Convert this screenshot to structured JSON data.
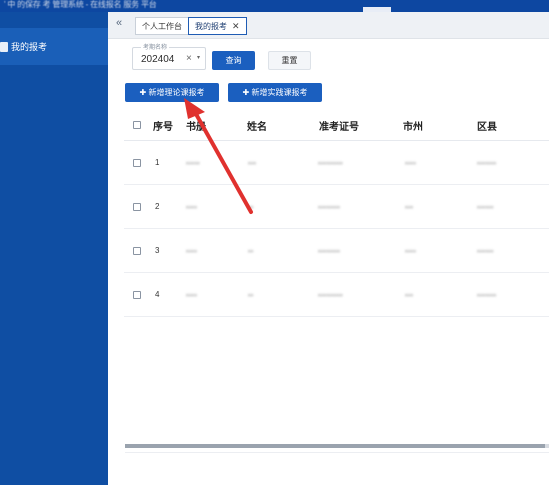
{
  "topbar": {
    "title": "' 中 的保存 考 管理系统 - 在线报名 服务 平台"
  },
  "sidebar": {
    "items": [
      {
        "label": "我的报考",
        "icon": "document-icon"
      }
    ]
  },
  "tabs": [
    {
      "label": "个人工作台"
    },
    {
      "label": "我的报考",
      "close": "✕"
    }
  ],
  "tabbar": {
    "collapse_glyph": "«"
  },
  "filter": {
    "label": "考期名称",
    "value": "202404",
    "clear_glyph": "×",
    "caret_glyph": "▾",
    "query_label": "查询",
    "reset_label": "重置"
  },
  "actions": {
    "add_theory_label": "✚ 新增理论课报考",
    "add_practice_label": "✚ 新增实践课报考"
  },
  "table": {
    "headers": [
      "序号",
      "书册",
      "姓名",
      "准考证号",
      "市州",
      "区县"
    ],
    "rows": [
      {
        "index": "1",
        "c1": "ꞏꞏꞏꞏꞏ",
        "c2": "ꞏꞏꞏ",
        "c3": "ꞏꞏꞏꞏꞏꞏꞏꞏꞏ",
        "c4": "ꞏꞏꞏꞏ",
        "c5": "ꞏꞏꞏꞏꞏꞏꞏ"
      },
      {
        "index": "2",
        "c1": "ꞏꞏꞏꞏ",
        "c2": "ꞏꞏ",
        "c3": "ꞏꞏꞏꞏꞏꞏꞏꞏ",
        "c4": "ꞏꞏꞏ",
        "c5": "ꞏꞏꞏꞏꞏꞏ"
      },
      {
        "index": "3",
        "c1": "ꞏꞏꞏꞏ",
        "c2": "ꞏꞏ",
        "c3": "ꞏꞏꞏꞏꞏꞏꞏꞏ",
        "c4": "ꞏꞏꞏꞏ",
        "c5": "ꞏꞏꞏꞏꞏꞏ"
      },
      {
        "index": "4",
        "c1": "ꞏꞏꞏꞏ",
        "c2": "ꞏꞏ",
        "c3": "ꞏꞏꞏꞏꞏꞏꞏꞏꞏ",
        "c4": "ꞏꞏꞏ",
        "c5": "ꞏꞏꞏꞏꞏꞏꞏ"
      }
    ]
  },
  "colors": {
    "primary": "#1b5fbf",
    "sidebar": "#0f4ea3",
    "arrow": "#e0312e"
  }
}
